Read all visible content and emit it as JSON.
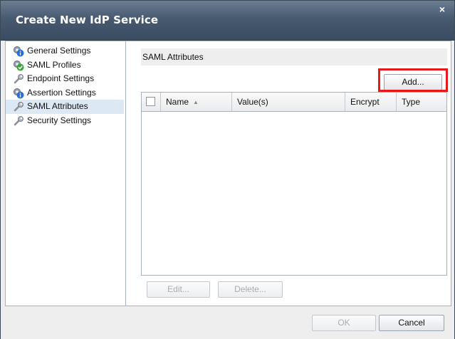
{
  "dialog": {
    "title": "Create New IdP Service",
    "close_label": "×"
  },
  "sidebar": {
    "items": [
      {
        "label": "General Settings",
        "icon": "gear-info-icon"
      },
      {
        "label": "SAML Profiles",
        "icon": "gear-check-icon"
      },
      {
        "label": "Endpoint Settings",
        "icon": "wrench-icon"
      },
      {
        "label": "Assertion Settings",
        "icon": "gear-info-icon"
      },
      {
        "label": "SAML Attributes",
        "icon": "wrench-icon",
        "selected": true
      },
      {
        "label": "Security Settings",
        "icon": "wrench-icon"
      }
    ]
  },
  "main": {
    "section_title": "SAML Attributes",
    "add_button": "Add...",
    "table": {
      "columns": [
        "Name",
        "Value(s)",
        "Encrypt",
        "Type"
      ],
      "rows": []
    },
    "edit_button": "Edit...",
    "delete_button": "Delete..."
  },
  "footer": {
    "ok_button": "OK",
    "cancel_button": "Cancel"
  },
  "colors": {
    "titlebar": "#475a70",
    "highlight": "#e41a1a",
    "selection": "#dde8f5"
  }
}
